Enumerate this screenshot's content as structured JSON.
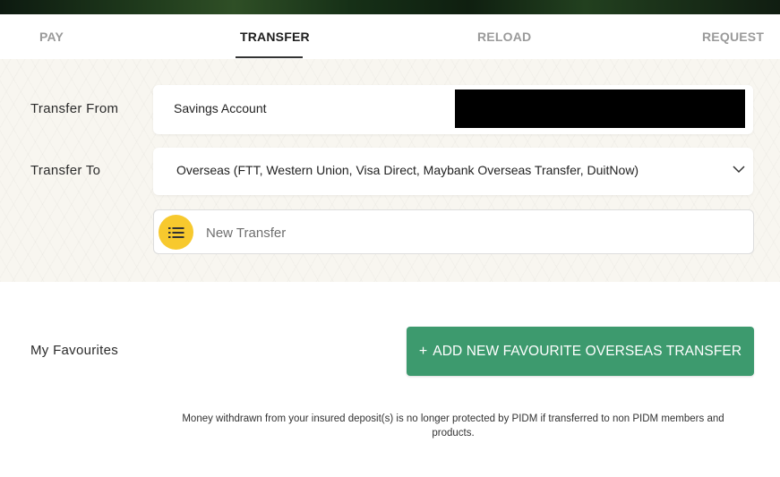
{
  "tabs": [
    {
      "label": "PAY",
      "active": false
    },
    {
      "label": "TRANSFER",
      "active": true
    },
    {
      "label": "RELOAD",
      "active": false
    },
    {
      "label": "REQUEST",
      "active": false
    }
  ],
  "form": {
    "from_label": "Transfer From",
    "from_value": "Savings Account",
    "to_label": "Transfer To",
    "to_value": "Overseas  (FTT, Western Union, Visa Direct, Maybank Overseas Transfer, DuitNow)",
    "new_transfer_label": "New Transfer"
  },
  "favourites": {
    "label": "My Favourites",
    "add_button_icon": "+",
    "add_button_label": "ADD NEW FAVOURITE OVERSEAS TRANSFER"
  },
  "disclaimer": "Money withdrawn from your insured deposit(s) is no longer protected by PIDM if transferred to non PIDM members and products.",
  "colors": {
    "accent_green": "#3d9a6e",
    "list_icon_yellow": "#f7c92e",
    "panel_bg": "#f8f6f0"
  },
  "icons": {
    "dropdown": "chevron-down-icon",
    "list": "list-icon"
  }
}
